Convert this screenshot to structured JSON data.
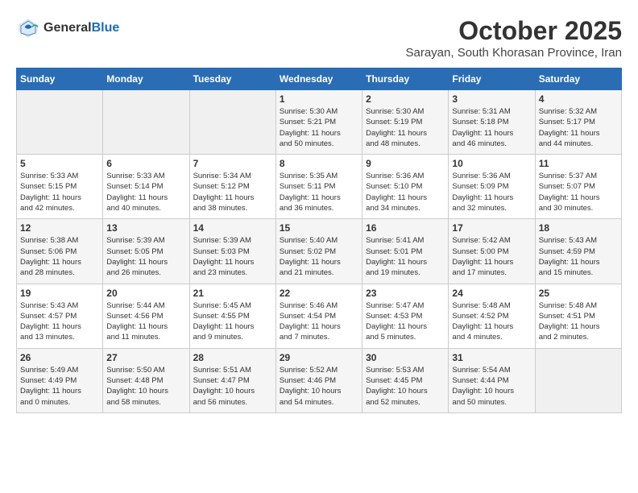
{
  "header": {
    "logo_line1": "General",
    "logo_line2": "Blue",
    "month_title": "October 2025",
    "subtitle": "Sarayan, South Khorasan Province, Iran"
  },
  "days_of_week": [
    "Sunday",
    "Monday",
    "Tuesday",
    "Wednesday",
    "Thursday",
    "Friday",
    "Saturday"
  ],
  "weeks": [
    [
      {
        "day": "",
        "info": ""
      },
      {
        "day": "",
        "info": ""
      },
      {
        "day": "",
        "info": ""
      },
      {
        "day": "1",
        "info": "Sunrise: 5:30 AM\nSunset: 5:21 PM\nDaylight: 11 hours\nand 50 minutes."
      },
      {
        "day": "2",
        "info": "Sunrise: 5:30 AM\nSunset: 5:19 PM\nDaylight: 11 hours\nand 48 minutes."
      },
      {
        "day": "3",
        "info": "Sunrise: 5:31 AM\nSunset: 5:18 PM\nDaylight: 11 hours\nand 46 minutes."
      },
      {
        "day": "4",
        "info": "Sunrise: 5:32 AM\nSunset: 5:17 PM\nDaylight: 11 hours\nand 44 minutes."
      }
    ],
    [
      {
        "day": "5",
        "info": "Sunrise: 5:33 AM\nSunset: 5:15 PM\nDaylight: 11 hours\nand 42 minutes."
      },
      {
        "day": "6",
        "info": "Sunrise: 5:33 AM\nSunset: 5:14 PM\nDaylight: 11 hours\nand 40 minutes."
      },
      {
        "day": "7",
        "info": "Sunrise: 5:34 AM\nSunset: 5:12 PM\nDaylight: 11 hours\nand 38 minutes."
      },
      {
        "day": "8",
        "info": "Sunrise: 5:35 AM\nSunset: 5:11 PM\nDaylight: 11 hours\nand 36 minutes."
      },
      {
        "day": "9",
        "info": "Sunrise: 5:36 AM\nSunset: 5:10 PM\nDaylight: 11 hours\nand 34 minutes."
      },
      {
        "day": "10",
        "info": "Sunrise: 5:36 AM\nSunset: 5:09 PM\nDaylight: 11 hours\nand 32 minutes."
      },
      {
        "day": "11",
        "info": "Sunrise: 5:37 AM\nSunset: 5:07 PM\nDaylight: 11 hours\nand 30 minutes."
      }
    ],
    [
      {
        "day": "12",
        "info": "Sunrise: 5:38 AM\nSunset: 5:06 PM\nDaylight: 11 hours\nand 28 minutes."
      },
      {
        "day": "13",
        "info": "Sunrise: 5:39 AM\nSunset: 5:05 PM\nDaylight: 11 hours\nand 26 minutes."
      },
      {
        "day": "14",
        "info": "Sunrise: 5:39 AM\nSunset: 5:03 PM\nDaylight: 11 hours\nand 23 minutes."
      },
      {
        "day": "15",
        "info": "Sunrise: 5:40 AM\nSunset: 5:02 PM\nDaylight: 11 hours\nand 21 minutes."
      },
      {
        "day": "16",
        "info": "Sunrise: 5:41 AM\nSunset: 5:01 PM\nDaylight: 11 hours\nand 19 minutes."
      },
      {
        "day": "17",
        "info": "Sunrise: 5:42 AM\nSunset: 5:00 PM\nDaylight: 11 hours\nand 17 minutes."
      },
      {
        "day": "18",
        "info": "Sunrise: 5:43 AM\nSunset: 4:59 PM\nDaylight: 11 hours\nand 15 minutes."
      }
    ],
    [
      {
        "day": "19",
        "info": "Sunrise: 5:43 AM\nSunset: 4:57 PM\nDaylight: 11 hours\nand 13 minutes."
      },
      {
        "day": "20",
        "info": "Sunrise: 5:44 AM\nSunset: 4:56 PM\nDaylight: 11 hours\nand 11 minutes."
      },
      {
        "day": "21",
        "info": "Sunrise: 5:45 AM\nSunset: 4:55 PM\nDaylight: 11 hours\nand 9 minutes."
      },
      {
        "day": "22",
        "info": "Sunrise: 5:46 AM\nSunset: 4:54 PM\nDaylight: 11 hours\nand 7 minutes."
      },
      {
        "day": "23",
        "info": "Sunrise: 5:47 AM\nSunset: 4:53 PM\nDaylight: 11 hours\nand 5 minutes."
      },
      {
        "day": "24",
        "info": "Sunrise: 5:48 AM\nSunset: 4:52 PM\nDaylight: 11 hours\nand 4 minutes."
      },
      {
        "day": "25",
        "info": "Sunrise: 5:48 AM\nSunset: 4:51 PM\nDaylight: 11 hours\nand 2 minutes."
      }
    ],
    [
      {
        "day": "26",
        "info": "Sunrise: 5:49 AM\nSunset: 4:49 PM\nDaylight: 11 hours\nand 0 minutes."
      },
      {
        "day": "27",
        "info": "Sunrise: 5:50 AM\nSunset: 4:48 PM\nDaylight: 10 hours\nand 58 minutes."
      },
      {
        "day": "28",
        "info": "Sunrise: 5:51 AM\nSunset: 4:47 PM\nDaylight: 10 hours\nand 56 minutes."
      },
      {
        "day": "29",
        "info": "Sunrise: 5:52 AM\nSunset: 4:46 PM\nDaylight: 10 hours\nand 54 minutes."
      },
      {
        "day": "30",
        "info": "Sunrise: 5:53 AM\nSunset: 4:45 PM\nDaylight: 10 hours\nand 52 minutes."
      },
      {
        "day": "31",
        "info": "Sunrise: 5:54 AM\nSunset: 4:44 PM\nDaylight: 10 hours\nand 50 minutes."
      },
      {
        "day": "",
        "info": ""
      }
    ]
  ]
}
